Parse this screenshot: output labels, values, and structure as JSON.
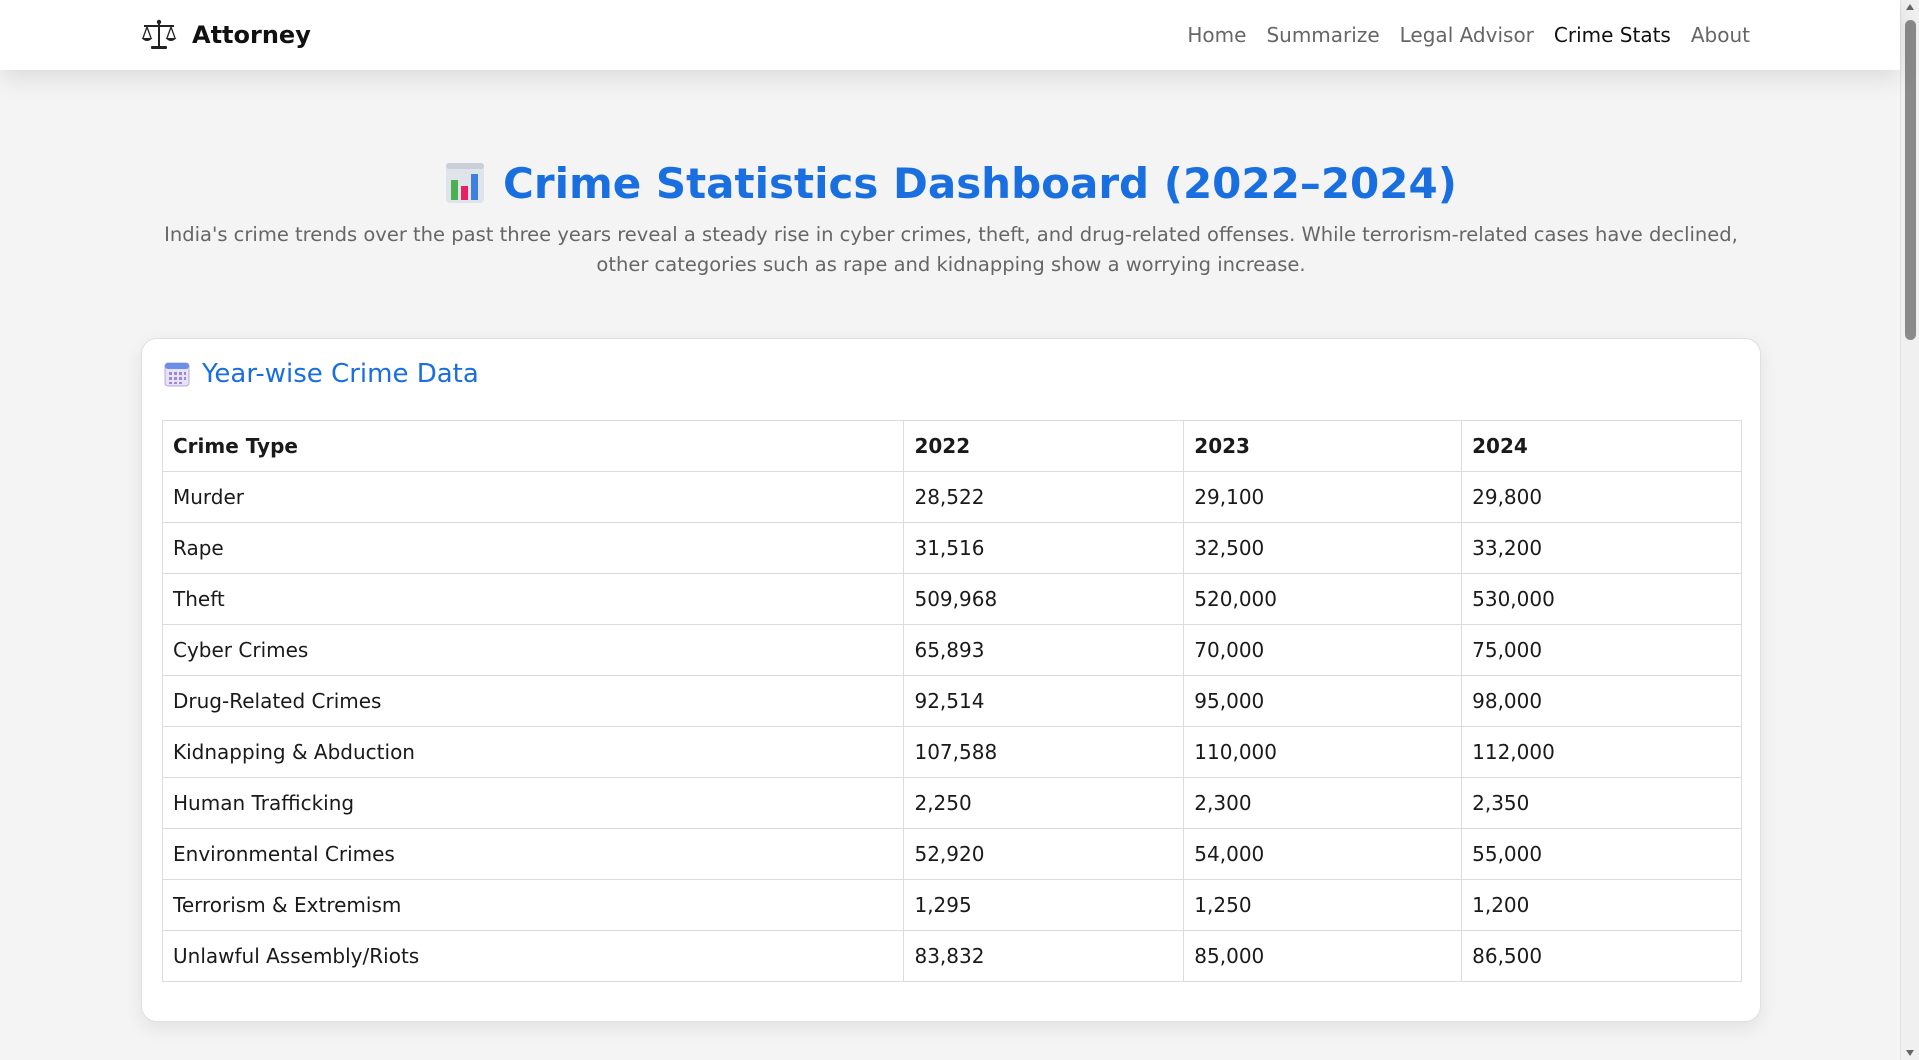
{
  "nav": {
    "brand": "Attorney",
    "brand_icon": "scales-icon",
    "links": [
      {
        "label": "Home",
        "active": false
      },
      {
        "label": "Summarize",
        "active": false
      },
      {
        "label": "Legal Advisor",
        "active": false
      },
      {
        "label": "Crime Stats",
        "active": true
      },
      {
        "label": "About",
        "active": false
      }
    ]
  },
  "hero": {
    "icon": "bar-chart-icon",
    "title": "Crime Statistics Dashboard (2022–2024)",
    "description": "India's crime trends over the past three years reveal a steady rise in cyber crimes, theft, and drug-related offenses. While terrorism-related cases have declined, other categories such as rape and kidnapping show a worrying increase."
  },
  "card": {
    "icon": "calendar-icon",
    "title": "Year-wise Crime Data"
  },
  "table": {
    "headers": [
      "Crime Type",
      "2022",
      "2023",
      "2024"
    ],
    "rows": [
      [
        "Murder",
        "28,522",
        "29,100",
        "29,800"
      ],
      [
        "Rape",
        "31,516",
        "32,500",
        "33,200"
      ],
      [
        "Theft",
        "509,968",
        "520,000",
        "530,000"
      ],
      [
        "Cyber Crimes",
        "65,893",
        "70,000",
        "75,000"
      ],
      [
        "Drug-Related Crimes",
        "92,514",
        "95,000",
        "98,000"
      ],
      [
        "Kidnapping & Abduction",
        "107,588",
        "110,000",
        "112,000"
      ],
      [
        "Human Trafficking",
        "2,250",
        "2,300",
        "2,350"
      ],
      [
        "Environmental Crimes",
        "52,920",
        "54,000",
        "55,000"
      ],
      [
        "Terrorism & Extremism",
        "1,295",
        "1,250",
        "1,200"
      ],
      [
        "Unlawful Assembly/Riots",
        "83,832",
        "85,000",
        "86,500"
      ]
    ]
  },
  "colors": {
    "accent": "#1a6fe0",
    "background": "#f4f4f4",
    "card": "#ffffff"
  }
}
